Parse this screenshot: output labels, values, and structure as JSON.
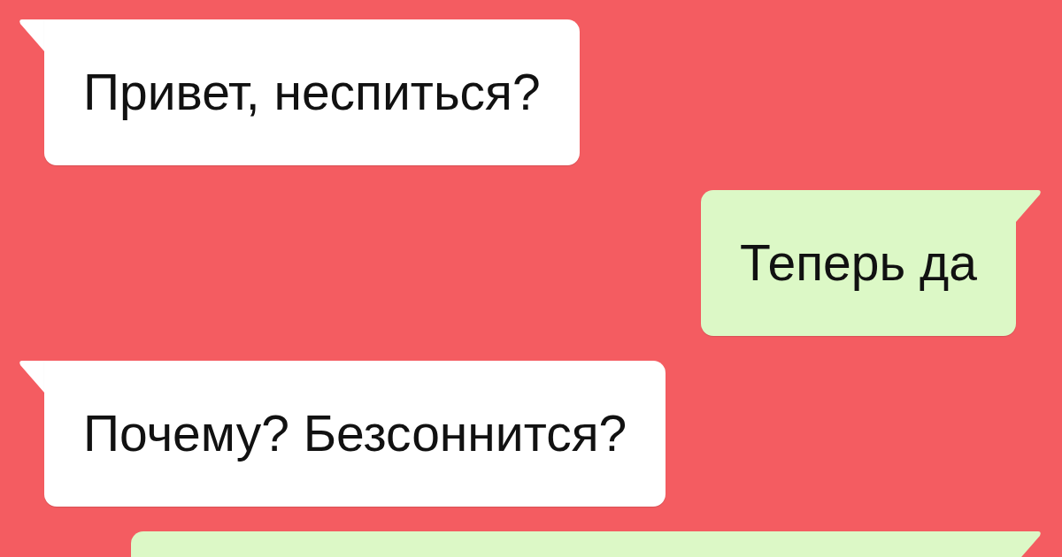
{
  "messages": [
    {
      "kind": "incoming",
      "text": "Привет, неспиться?"
    },
    {
      "kind": "outgoing",
      "text": "Теперь да"
    },
    {
      "kind": "incoming",
      "text": "Почему? Безсоннится?"
    },
    {
      "kind": "outgoing"
    }
  ]
}
